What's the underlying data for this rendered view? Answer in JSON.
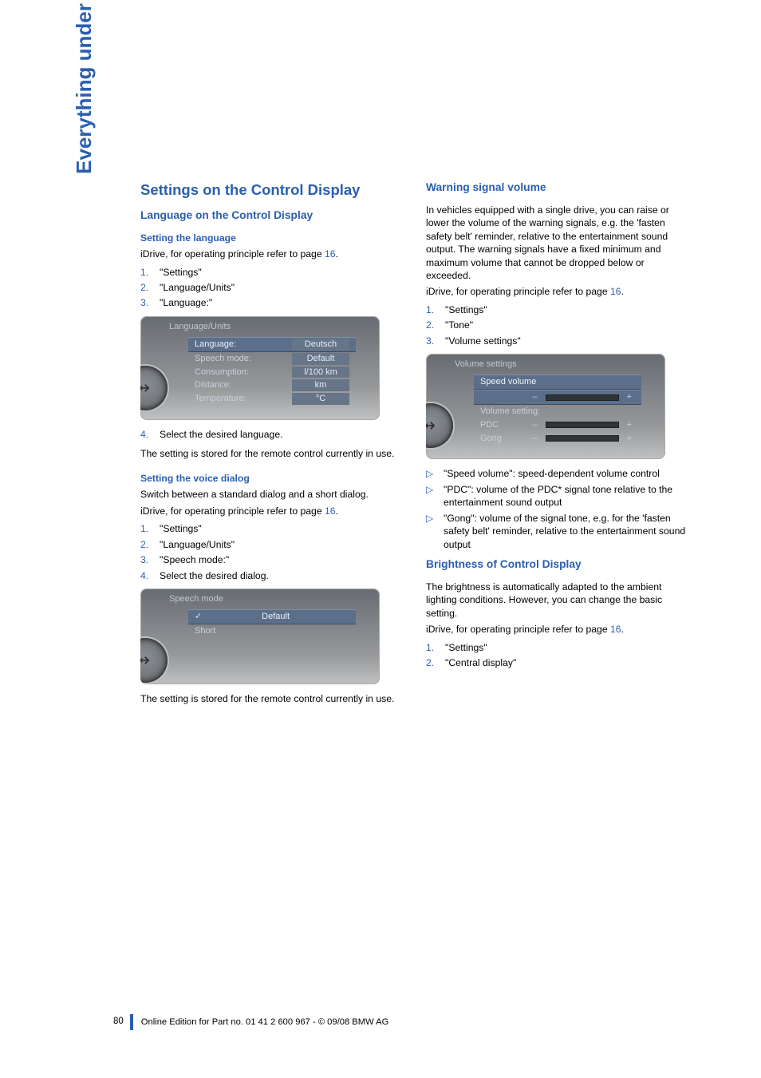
{
  "side_tab": "Everything under control",
  "left": {
    "title": "Settings on the Control Display",
    "h2_1": "Language on the Control Display",
    "h3_1": "Setting the language",
    "idrive_ref": "iDrive, for operating principle refer to page ",
    "idrive_page": "16",
    "period": ".",
    "steps1": {
      "1": "\"Settings\"",
      "2": "\"Language/Units\"",
      "3": "\"Language:\""
    },
    "screenshot1": {
      "crumb": "Language/Units",
      "r1l": "Language:",
      "r1v": "Deutsch",
      "r2l": "Speech mode:",
      "r2v": "Default",
      "r3l": "Consumption:",
      "r3v": "l/100 km",
      "r4l": "Distance:",
      "r4v": "km",
      "r5l": "Temperature:",
      "r5v": "°C"
    },
    "step4": "Select the desired language.",
    "stored": "The setting is stored for the remote control currently in use.",
    "h3_2": "Setting the voice dialog",
    "switch": "Switch between a standard dialog and a short dialog.",
    "steps2": {
      "1": "\"Settings\"",
      "2": "\"Language/Units\"",
      "3": "\"Speech mode:\"",
      "4": "Select the desired dialog."
    },
    "screenshot2": {
      "crumb": "Speech mode",
      "r1": "Default",
      "r2": "Short"
    },
    "stored2": "The setting is stored for the remote control currently in use."
  },
  "right": {
    "h2_1": "Warning signal volume",
    "para1": "In vehicles equipped with a single drive, you can raise or lower the volume of the warning signals, e.g. the 'fasten safety belt' reminder, relative to the entertainment sound output. The warning signals have a fixed minimum and maximum volume that cannot be dropped below or exceeded.",
    "steps1": {
      "1": "\"Settings\"",
      "2": "\"Tone\"",
      "3": "\"Volume settings\""
    },
    "screenshot": {
      "crumb": "Volume settings",
      "r1": "Speed volume",
      "r2": "Volume setting:",
      "r3": "PDC",
      "r4": "Gong"
    },
    "bullets": {
      "b1": "\"Speed volume\": speed-dependent volume control",
      "b2": "\"PDC\": volume of the PDC* signal tone relative to the entertainment sound output",
      "b3": "\"Gong\": volume of the signal tone, e.g. for the 'fasten safety belt' reminder, relative to the entertainment sound output"
    },
    "h2_2": "Brightness of Control Display",
    "para2": "The brightness is automatically adapted to the ambient lighting conditions. However, you can change the basic setting.",
    "steps2": {
      "1": "\"Settings\"",
      "2": "\"Central display\""
    }
  },
  "footer": {
    "page": "80",
    "text": "Online Edition for Part no. 01 41 2 600 967  - © 09/08 BMW AG"
  }
}
